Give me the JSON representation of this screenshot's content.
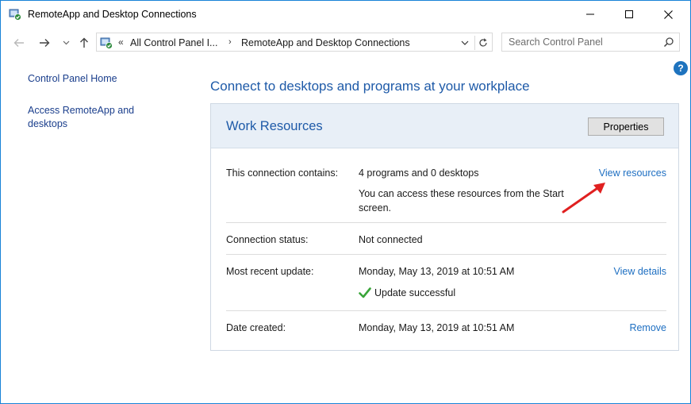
{
  "window": {
    "title": "RemoteApp and Desktop Connections"
  },
  "address_bar": {
    "overflow": "«",
    "crumbs": [
      "All Control Panel I...",
      "RemoteApp and Desktop Connections"
    ],
    "separator": "›"
  },
  "search": {
    "placeholder": "Search Control Panel"
  },
  "help": {
    "label": "?"
  },
  "sidebar": {
    "items": [
      {
        "label": "Control Panel Home"
      },
      {
        "label": "Access RemoteApp and desktops"
      }
    ]
  },
  "main": {
    "heading": "Connect to desktops and programs at your workplace",
    "panel": {
      "title": "Work Resources",
      "properties_label": "Properties",
      "rows": [
        {
          "label": "This connection contains:",
          "value": "4 programs and 0 desktops",
          "note": "You can access these resources from the Start screen.",
          "link": "View resources"
        },
        {
          "label": "Connection status:",
          "value": "Not connected"
        },
        {
          "label": "Most recent update:",
          "value": "Monday, May 13, 2019 at 10:51 AM",
          "status": "Update successful",
          "link": "View details"
        },
        {
          "label": "Date created:",
          "value": "Monday, May 13, 2019 at 10:51 AM",
          "link": "Remove"
        }
      ]
    }
  },
  "colors": {
    "accent_blue": "#1e5aa8",
    "link_blue": "#1e6fc2",
    "panel_header_bg": "#e8eff7",
    "success_green": "#3aa53a",
    "annotation_red": "#e02020"
  }
}
